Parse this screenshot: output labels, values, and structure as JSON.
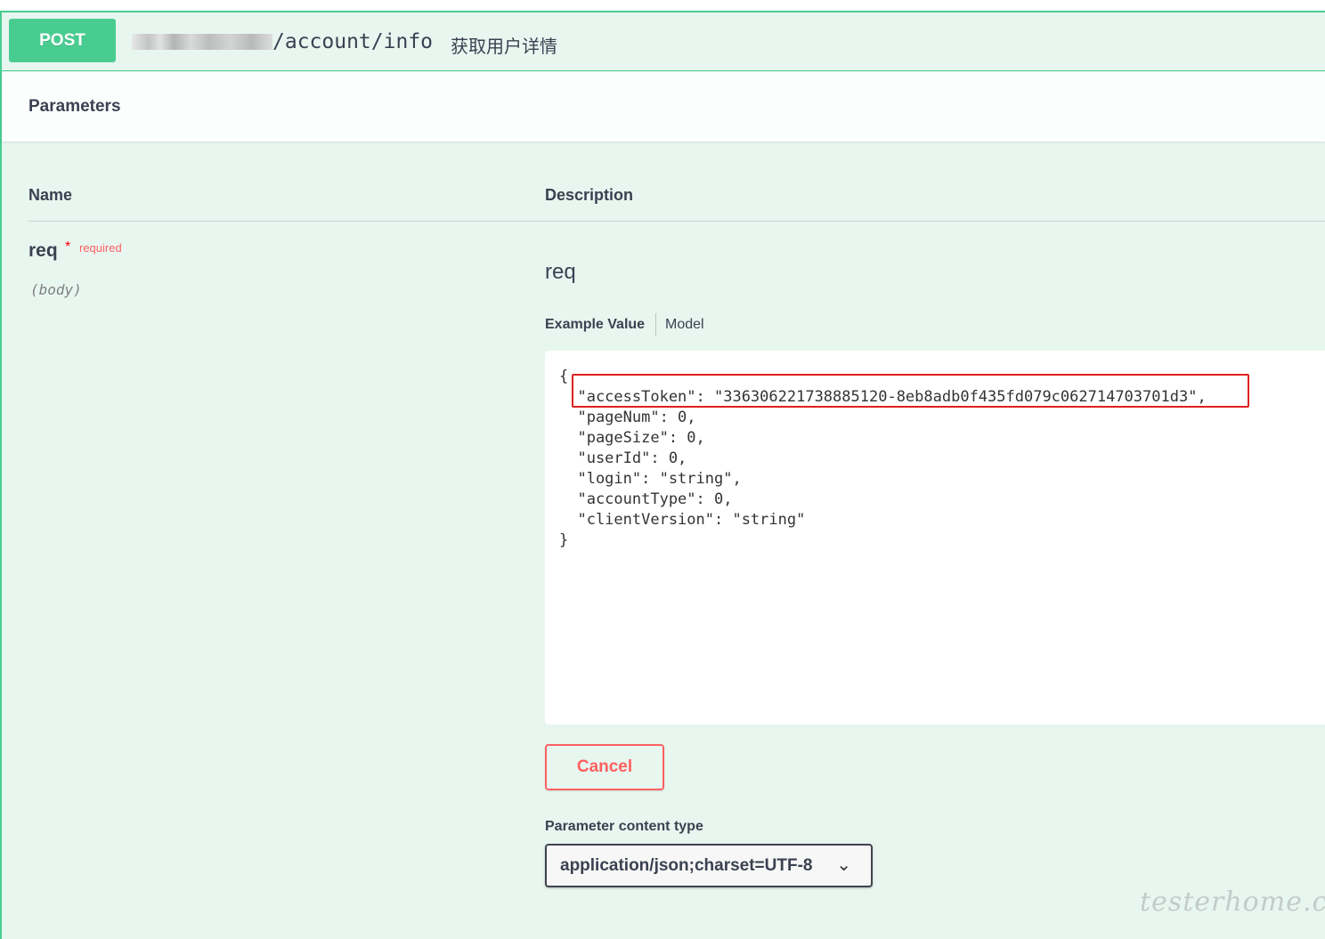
{
  "operation": {
    "method": "POST",
    "path": "/account/info",
    "summary": "获取用户详情"
  },
  "parameters": {
    "title": "Parameters",
    "columns": {
      "name": "Name",
      "description": "Description"
    },
    "param": {
      "name": "req",
      "required_star": "*",
      "required_label": "required",
      "in": "(body)",
      "description": "req"
    },
    "tabs": {
      "example": "Example Value",
      "model": "Model"
    },
    "example_lines": [
      "{",
      "  \"accessToken\": \"336306221738885120-8eb8adb0f435fd079c062714703701d3\",",
      "  \"pageNum\": 0,",
      "  \"pageSize\": 0,",
      "  \"userId\": 0,",
      "  \"login\": \"string\",",
      "  \"accountType\": 0,",
      "  \"clientVersion\": \"string\"",
      "}"
    ],
    "cancel_label": "Cancel",
    "content_type_label": "Parameter content type",
    "content_type_value": "application/json;charset=UTF-8",
    "chevron_icon": "chevron-down-icon"
  },
  "watermark": "testerhome.com",
  "colors": {
    "post_green": "#49cc90",
    "block_bg": "#e8f6f0",
    "required_red": "#ff6060",
    "highlight_red": "#e02020"
  }
}
